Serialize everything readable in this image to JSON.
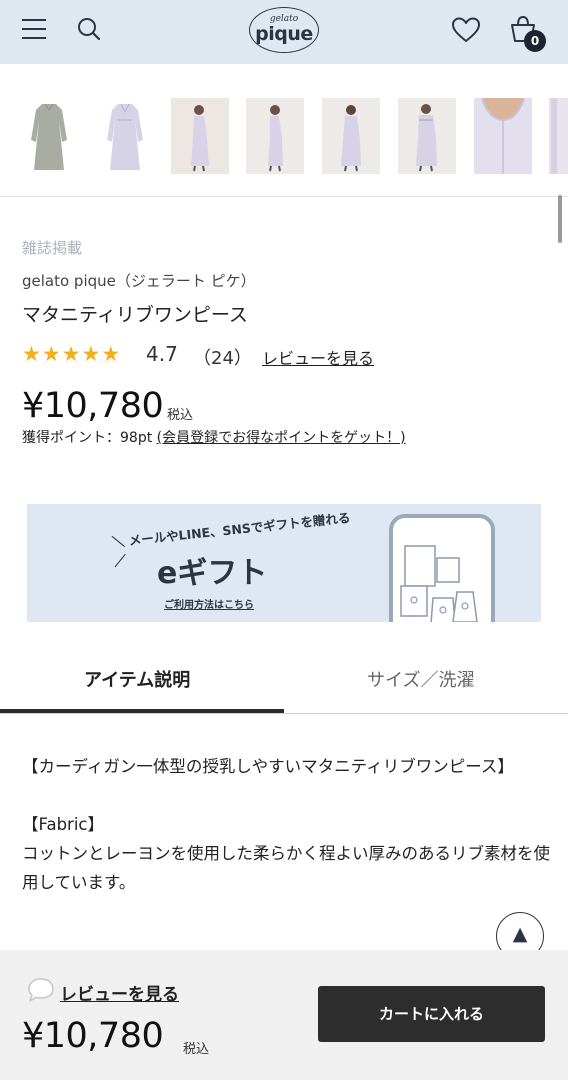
{
  "header": {
    "logo_top": "gelato",
    "logo_main": "pique",
    "cart_count": "0"
  },
  "product": {
    "tag": "雑誌掲載",
    "brand": "gelato pique（ジェラート ピケ）",
    "name": "マタニティリブワンピース",
    "rating": "4.7",
    "review_count": "（24）",
    "rating_stars": 5,
    "review_link": "レビューを見る",
    "price": "¥10,780",
    "tax_label": "税込",
    "points_text": "獲得ポイント：98pt ",
    "points_link": "(会員登録でお得なポイントをゲット！)"
  },
  "banner": {
    "tagline": "＼ メールやLINE、SNSでギフトを贈れる ／",
    "title": "eギフト",
    "howto": "ご利用方法はこちら"
  },
  "tabs": [
    {
      "label": "アイテム説明"
    },
    {
      "label": "サイズ／洗濯"
    }
  ],
  "description": {
    "p1": "【カーディガン一体型の授乳しやすいマタニティリブワンピース】",
    "p2_title": "【Fabric】",
    "p2_body": "コットンとレーヨンを使用した柔らかく程よい厚みのあるリブ素材を使用しています。"
  },
  "footer": {
    "review_link": "レビューを見る",
    "price": "¥10,780",
    "tax_label": "税込",
    "cart_button": "カートに入れる"
  },
  "colors": {
    "header_bg": "#dfe7f1",
    "star": "#f2b01e",
    "cart_button": "#2d2d2d"
  }
}
